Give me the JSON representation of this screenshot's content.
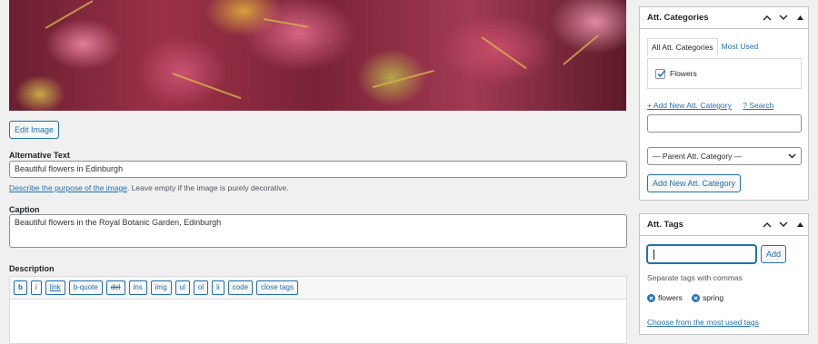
{
  "media": {
    "edit_image_label": "Edit Image",
    "alt_text": {
      "label": "Alternative Text",
      "value": "Beautiful flowers in Edinburgh"
    },
    "alt_help": {
      "link": "Describe the purpose of the image",
      "text": ". Leave empty if the image is purely decorative."
    },
    "caption": {
      "label": "Caption",
      "value": "Beautiful flowers in the Royal Botanic Garden, Edinburgh"
    },
    "description": {
      "label": "Description",
      "toolbar": [
        "b",
        "i",
        "link",
        "b-quote",
        "del",
        "ins",
        "img",
        "ul",
        "ol",
        "li",
        "code",
        "close tags"
      ]
    }
  },
  "categories_panel": {
    "title": "Att. Categories",
    "tabs": [
      "All Att. Categories",
      "Most Used"
    ],
    "items": [
      {
        "label": "Flowers",
        "checked": true
      }
    ],
    "add_new_link": "+ Add New Att. Category",
    "search_link": "? Search",
    "parent_select": "— Parent Att. Category —",
    "add_button": "Add New Att. Category"
  },
  "tags_panel": {
    "title": "Att. Tags",
    "add_button": "Add",
    "hint": "Separate tags with commas",
    "tags": [
      "flowers",
      "spring"
    ],
    "most_used_link": "Choose from the most used tags"
  },
  "colors": {
    "accent": "#2271b1",
    "background": "#f0f0f1"
  }
}
